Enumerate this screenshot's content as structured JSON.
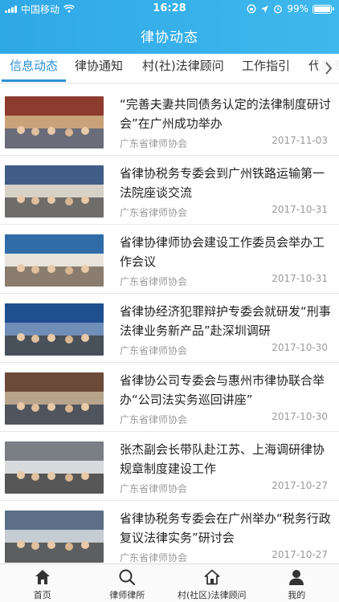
{
  "status_bar": {
    "carrier": "中国移动",
    "time": "16:28",
    "battery_text": "99%",
    "battery_level": 0.99
  },
  "header": {
    "title": "律协动态"
  },
  "tabs": [
    {
      "label": "信息动态",
      "active": true
    },
    {
      "label": "律协通知",
      "active": false
    },
    {
      "label": "村(社)法律顾问",
      "active": false
    },
    {
      "label": "工作指引",
      "active": false
    },
    {
      "label": "代表专",
      "active": false
    }
  ],
  "news": [
    {
      "title": "“完善夫妻共同债务认定的法律制度研讨会”在广州成功举办",
      "source": "广东省律师协会",
      "date": "2017-11-03"
    },
    {
      "title": "省律协税务专委会到广州铁路运输第一法院座谈交流",
      "source": "广东省律师协会",
      "date": "2017-10-31"
    },
    {
      "title": "省律协律师协会建设工作委员会举办工作会议",
      "source": "广东省律师协会",
      "date": "2017-10-31"
    },
    {
      "title": "省律协经济犯罪辩护专委会就研发“刑事法律业务新产品”赴深圳调研",
      "source": "广东省律师协会",
      "date": "2017-10-30"
    },
    {
      "title": "省律协公司专委会与惠州市律协联合举办“公司法实务巡回讲座”",
      "source": "广东省律师协会",
      "date": "2017-10-30"
    },
    {
      "title": "张杰副会长带队赴江苏、上海调研律协规章制度建设工作",
      "source": "广东省律师协会",
      "date": "2017-10-27"
    },
    {
      "title": "省律协税务专委会在广州举办“税务行政复议法律实务”研讨会",
      "source": "广东省律师协会",
      "date": "2017-10-27"
    }
  ],
  "bottom_nav": [
    {
      "label": "首页",
      "icon": "home-icon"
    },
    {
      "label": "律师律所",
      "icon": "search-icon"
    },
    {
      "label": "村(社区)法律顾问",
      "icon": "house-icon"
    },
    {
      "label": "我的",
      "icon": "user-icon"
    }
  ],
  "colors": {
    "accent": "#2a8fd6",
    "header": "#3ab0ea"
  }
}
